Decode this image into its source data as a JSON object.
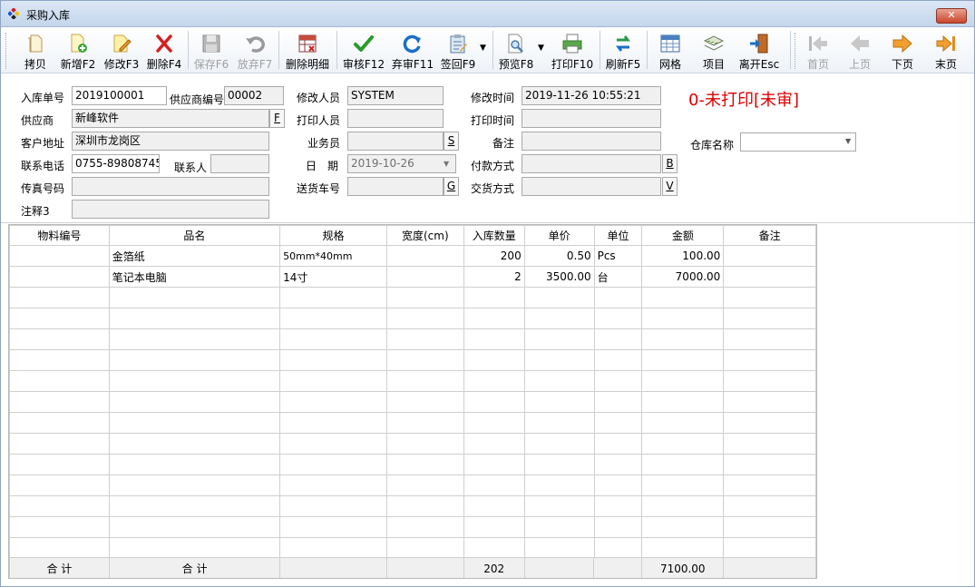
{
  "window": {
    "title": "采购入库",
    "close_label": "✕"
  },
  "toolbar": {
    "copy": "拷贝",
    "new": "新增F2",
    "edit": "修改F3",
    "delete": "删除F4",
    "save": "保存F6",
    "discard": "放弃F7",
    "delete_detail": "删除明细",
    "audit": "审核F12",
    "unaudit": "弃审F11",
    "sign": "签回F9",
    "preview": "预览F8",
    "print": "打印F10",
    "refresh": "刷新F5",
    "grid": "网格",
    "item": "项目",
    "exit": "离开Esc",
    "first": "首页",
    "prev": "上页",
    "next": "下页",
    "last": "末页"
  },
  "form": {
    "order_no_label": "入库单号",
    "order_no": "2019100001",
    "supplier_code_label": "供应商编号",
    "supplier_code": "00002",
    "modifier_label": "修改人员",
    "modifier": "SYSTEM",
    "modify_time_label": "修改时间",
    "modify_time": "2019-11-26 10:55:21",
    "supplier_label": "供应商",
    "supplier": "新峰软件",
    "supplier_btn": "F",
    "printer_label": "打印人员",
    "printer": "",
    "print_time_label": "打印时间",
    "print_time": "",
    "address_label": "客户地址",
    "address": "深圳市龙岗区",
    "salesman_label": "业务员",
    "salesman": "",
    "salesman_btn": "S",
    "remark_label": "备注",
    "remark": "",
    "warehouse_label": "仓库名称",
    "warehouse": "",
    "phone_label": "联系电话",
    "phone": "0755-89808745",
    "contact_label": "联系人",
    "contact": "",
    "date_label": "日　期",
    "date": "2019-10-26",
    "payment_label": "付款方式",
    "payment": "",
    "payment_btn": "B",
    "fax_label": "传真号码",
    "fax": "",
    "truck_label": "送货车号",
    "truck": "",
    "truck_btn": "G",
    "delivery_label": "交货方式",
    "delivery": "",
    "delivery_btn": "V",
    "note3_label": "注释3",
    "note3": "",
    "status": "0-未打印[未审]"
  },
  "table": {
    "headers": [
      "物料编号",
      "品名",
      "规格",
      "宽度(cm)",
      "入库数量",
      "单价",
      "单位",
      "金额",
      "备注"
    ],
    "rows": [
      [
        "",
        "金箔纸",
        "50mm*40mm",
        "",
        "200",
        "0.50",
        "Pcs",
        "100.00",
        ""
      ],
      [
        "",
        "笔记本电脑",
        "14寸",
        "",
        "2",
        "3500.00",
        "台",
        "7000.00",
        ""
      ]
    ],
    "footer": [
      "合 计",
      "合 计",
      "",
      "",
      "202",
      "",
      "",
      "7100.00",
      ""
    ]
  },
  "colors": {
    "status": "#e00000",
    "titlebar": "#c4d6ec"
  }
}
